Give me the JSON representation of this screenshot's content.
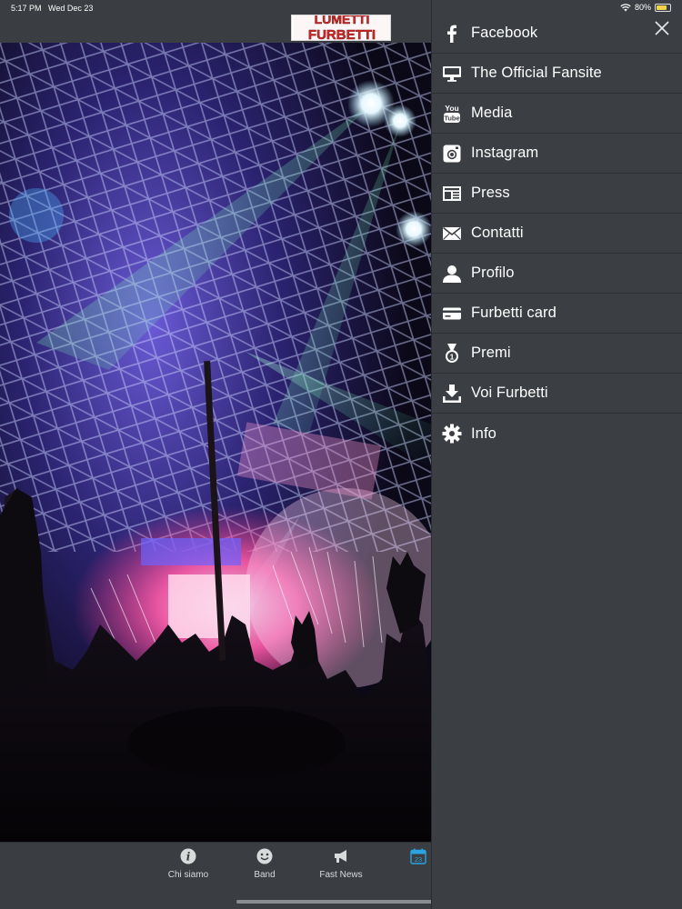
{
  "status_bar": {
    "time": "5:17 PM",
    "date": "Wed Dec 23",
    "battery": "80%",
    "battery_level": 0.8
  },
  "header": {
    "logo_text_line1": "LUMETTI",
    "logo_text_line2": "FURBETTI"
  },
  "tab_bar": {
    "tabs": [
      {
        "label": "Chi siamo",
        "icon": "info-circle-icon"
      },
      {
        "label": "Band",
        "icon": "smiley-icon"
      },
      {
        "label": "Fast News",
        "icon": "megaphone-icon"
      },
      {
        "label": "",
        "icon": "calendar-icon",
        "calendar_day": "23"
      }
    ]
  },
  "side_menu": {
    "items": [
      {
        "label": "Facebook",
        "icon": "facebook-icon"
      },
      {
        "label": "The Official Fansite",
        "icon": "monitor-icon"
      },
      {
        "label": "Media",
        "icon": "youtube-icon"
      },
      {
        "label": "Instagram",
        "icon": "instagram-icon"
      },
      {
        "label": "Press",
        "icon": "newspaper-icon"
      },
      {
        "label": "Contatti",
        "icon": "envelope-icon"
      },
      {
        "label": "Profilo",
        "icon": "user-icon"
      },
      {
        "label": "Furbetti card",
        "icon": "credit-card-icon"
      },
      {
        "label": "Premi",
        "icon": "medal-icon"
      },
      {
        "label": "Voi Furbetti",
        "icon": "download-icon"
      },
      {
        "label": "Info",
        "icon": "gear-icon"
      }
    ]
  },
  "colors": {
    "background": "#3b3e42",
    "text": "#ffffff",
    "calendar_accent": "#2aa3e0"
  }
}
